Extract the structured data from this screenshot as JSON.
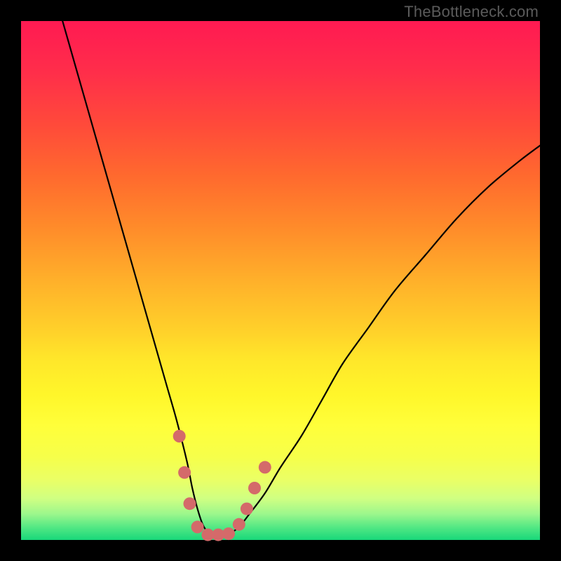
{
  "watermark": "TheBottleneck.com",
  "gradient": {
    "stops": [
      {
        "offset": 0.0,
        "color": "#ff1a52"
      },
      {
        "offset": 0.1,
        "color": "#ff2e4a"
      },
      {
        "offset": 0.2,
        "color": "#ff4a3a"
      },
      {
        "offset": 0.3,
        "color": "#ff6a2e"
      },
      {
        "offset": 0.4,
        "color": "#ff8c2a"
      },
      {
        "offset": 0.5,
        "color": "#ffb02a"
      },
      {
        "offset": 0.6,
        "color": "#ffd22a"
      },
      {
        "offset": 0.65,
        "color": "#ffe62a"
      },
      {
        "offset": 0.72,
        "color": "#fff62a"
      },
      {
        "offset": 0.78,
        "color": "#ffff3a"
      },
      {
        "offset": 0.84,
        "color": "#f6ff4a"
      },
      {
        "offset": 0.885,
        "color": "#eaff66"
      },
      {
        "offset": 0.92,
        "color": "#d0ff82"
      },
      {
        "offset": 0.95,
        "color": "#9cf78c"
      },
      {
        "offset": 0.975,
        "color": "#54e884"
      },
      {
        "offset": 1.0,
        "color": "#18d87a"
      }
    ]
  },
  "chart_data": {
    "type": "line",
    "title": "",
    "xlabel": "",
    "ylabel": "",
    "xlim": [
      0,
      100
    ],
    "ylim": [
      0,
      100
    ],
    "series": [
      {
        "name": "bottleneck-curve",
        "x": [
          8,
          10,
          12,
          14,
          16,
          18,
          20,
          22,
          24,
          26,
          28,
          30,
          32,
          33,
          34,
          35,
          36,
          37,
          38,
          40,
          42,
          44,
          47,
          50,
          54,
          58,
          62,
          67,
          72,
          78,
          84,
          90,
          96,
          100
        ],
        "y": [
          100,
          93,
          86,
          79,
          72,
          65,
          58,
          51,
          44,
          37,
          30,
          23,
          15,
          10,
          6,
          3,
          1.5,
          1,
          1,
          1.2,
          2.5,
          5,
          9,
          14,
          20,
          27,
          34,
          41,
          48,
          55,
          62,
          68,
          73,
          76
        ]
      }
    ],
    "markers": {
      "name": "highlight-dots",
      "color": "#d46a6a",
      "radius_px": 9,
      "points": [
        {
          "x": 30.5,
          "y": 20
        },
        {
          "x": 31.5,
          "y": 13
        },
        {
          "x": 32.5,
          "y": 7
        },
        {
          "x": 34,
          "y": 2.5
        },
        {
          "x": 36,
          "y": 1
        },
        {
          "x": 38,
          "y": 1
        },
        {
          "x": 40,
          "y": 1.2
        },
        {
          "x": 42,
          "y": 3
        },
        {
          "x": 43.5,
          "y": 6
        },
        {
          "x": 45,
          "y": 10
        },
        {
          "x": 47,
          "y": 14
        }
      ]
    }
  }
}
